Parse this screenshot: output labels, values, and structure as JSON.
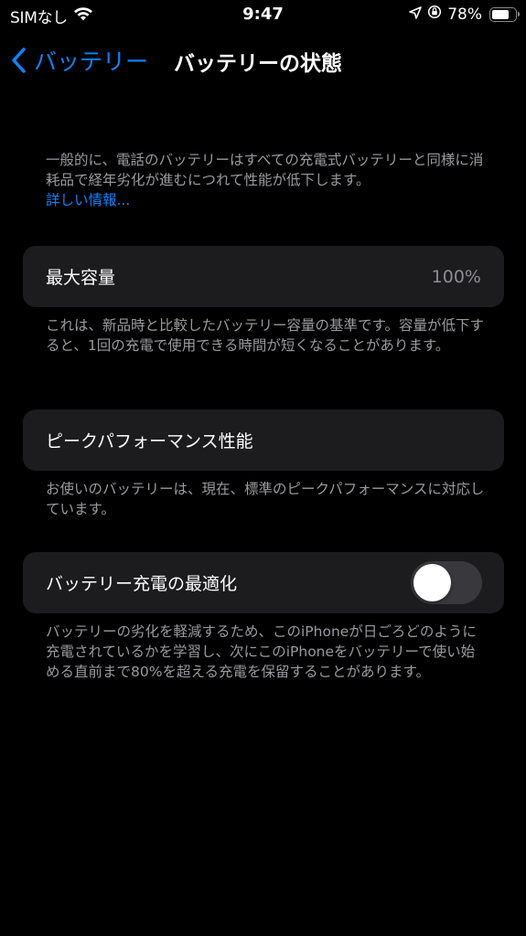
{
  "status_bar": {
    "carrier": "SIMなし",
    "time": "9:47",
    "battery_percent_label": "78%",
    "battery_level": 0.78
  },
  "nav": {
    "back_label": "バッテリー",
    "title": "バッテリーの状態"
  },
  "intro": {
    "text": "一般的に、電話のバッテリーはすべての充電式バッテリーと同様に消耗品で経年劣化が進むにつれて性能が低下します。",
    "link": "詳しい情報..."
  },
  "max_capacity": {
    "label": "最大容量",
    "value": "100%",
    "footnote": "これは、新品時と比較したバッテリー容量の基準です。容量が低下すると、1回の充電で使用できる時間が短くなることがあります。"
  },
  "peak_performance": {
    "label": "ピークパフォーマンス性能",
    "footnote": "お使いのバッテリーは、現在、標準のピークパフォーマンスに対応しています。"
  },
  "optimized_charging": {
    "label": "バッテリー充電の最適化",
    "enabled": false,
    "footnote": "バッテリーの劣化を軽減するため、このiPhoneが日ごろどのように充電されているかを学習し、次にこのiPhoneをバッテリーで使い始める直前まで80%を超える充電を保留することがあります。"
  },
  "colors": {
    "background": "#000000",
    "card": "#1c1c1e",
    "accent": "#0a84ff",
    "secondary_text": "#9a9a9f",
    "toggle_off": "#39393d"
  }
}
